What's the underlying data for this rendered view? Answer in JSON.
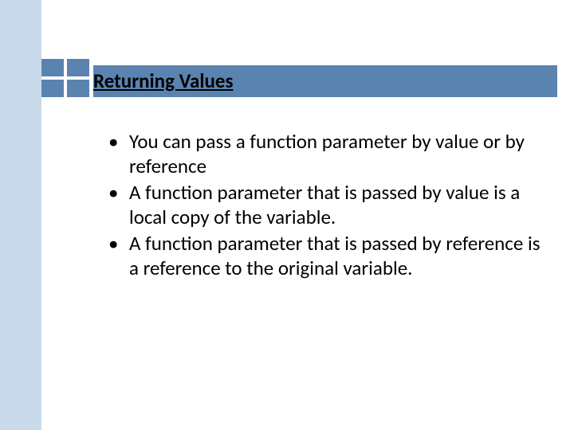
{
  "title": "Returning Values",
  "bullets": [
    "You can pass a function parameter by value or by reference",
    "A function parameter that is passed by value is a local copy of the variable.",
    "A function parameter that is passed by reference is a reference to the original variable."
  ]
}
